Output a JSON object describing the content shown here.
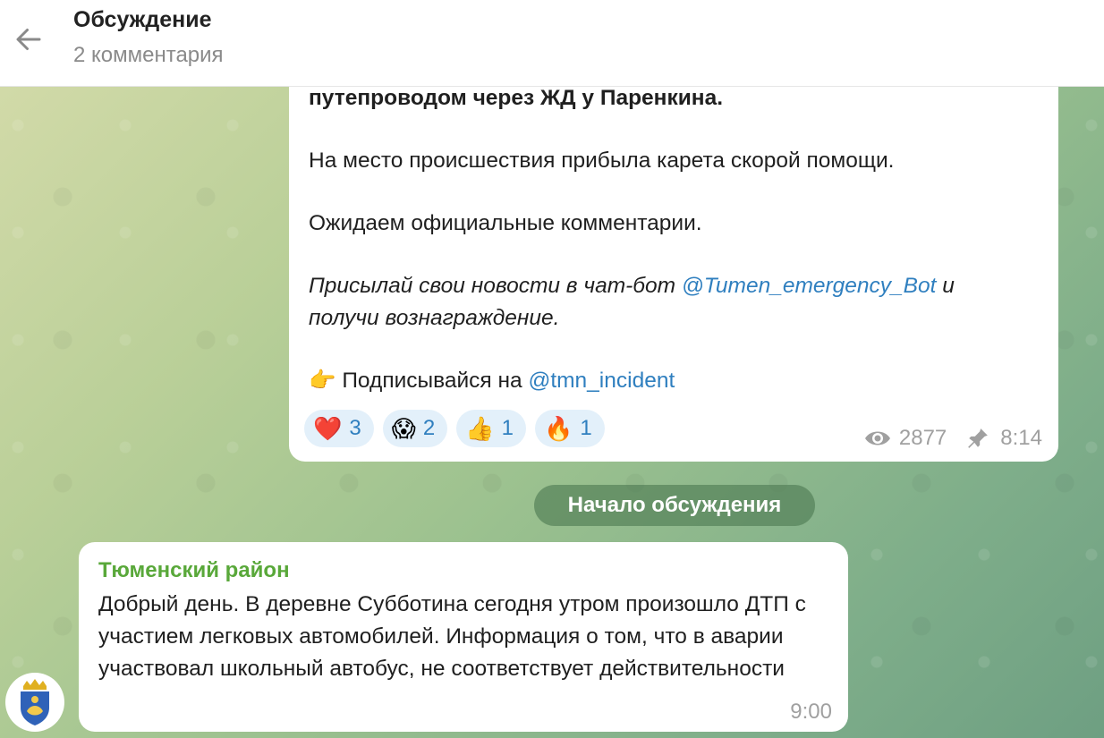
{
  "header": {
    "title": "Обсуждение",
    "subtitle": "2 комментария",
    "back_icon": "arrow-left-icon"
  },
  "post": {
    "lines": {
      "bold_tail": "путепроводом через ЖД у Паренкина.",
      "ambulance": "На место происшествия прибыла карета скорой помощи.",
      "awaiting": "Ожидаем официальные комментарии.",
      "promo_part1": "Присылай свои новости в чат-бот ",
      "promo_link": "@Tumen_emergency_Bot",
      "promo_part2": " и",
      "promo_line2": "получи вознаграждение.",
      "subscribe_emoji": "👉",
      "subscribe_text": " Подписывайся на ",
      "subscribe_link": "@tmn_incident"
    },
    "reactions": [
      {
        "emoji": "❤️",
        "count": "3"
      },
      {
        "emoji": "😱",
        "count": "2"
      },
      {
        "emoji": "👍",
        "count": "1"
      },
      {
        "emoji": "🔥",
        "count": "1"
      }
    ],
    "views": "2877",
    "time": "8:14",
    "views_icon": "eye-icon",
    "pin_icon": "pin-icon"
  },
  "divider": {
    "label": "Начало обсуждения"
  },
  "comment": {
    "author": "Тюменский район",
    "text": "Добрый день. В деревне Субботина сегодня утром произошло ДТП с участием легковых автомобилей. Информация о том, что в аварии участвовал школьный автобус, не соответствует действительности",
    "time": "9:00"
  },
  "colors": {
    "link": "#2f7fbf",
    "author": "#59a83a",
    "reaction_bg": "#e3f0fa"
  }
}
